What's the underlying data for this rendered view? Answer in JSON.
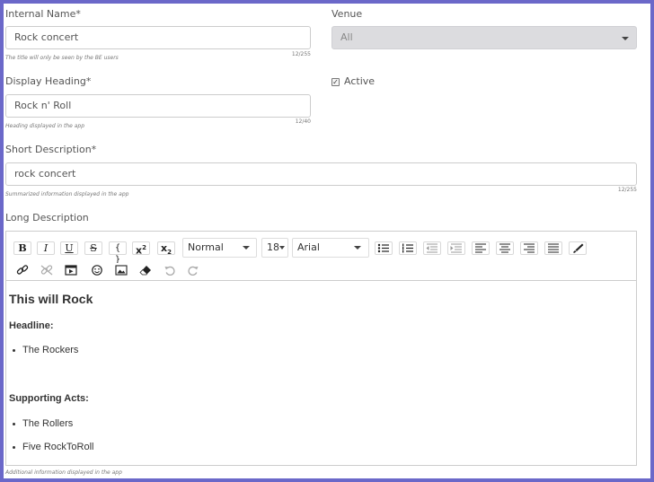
{
  "internal_name": {
    "label": "Internal Name*",
    "value": "Rock concert",
    "hint": "The title will only be seen by the BE users",
    "counter": "12/255"
  },
  "venue": {
    "label": "Venue",
    "selected": "All"
  },
  "display_heading": {
    "label": "Display Heading*",
    "value": "Rock n' Roll",
    "hint": "Heading displayed in the app",
    "counter": "12/40"
  },
  "active": {
    "label": "Active",
    "checked": true
  },
  "short_description": {
    "label": "Short Description*",
    "value": "rock concert",
    "hint": "Summarized information displayed in the app",
    "counter": "12/255"
  },
  "long_description": {
    "label": "Long Description",
    "hint": "Additional information displayed in the app",
    "toolbar": {
      "bold": "B",
      "italic": "I",
      "underline": "U",
      "strike": "S",
      "code": "{ }",
      "superscript_base": "x",
      "superscript_mark": "2",
      "subscript_base": "x",
      "subscript_mark": "2",
      "format": "Normal",
      "font_size": "18",
      "font_family": "Arial"
    },
    "content": {
      "title": "This will Rock",
      "headline_label": "Headline:",
      "headline_items": [
        "The Rockers"
      ],
      "support_label": "Supporting Acts:",
      "support_items": [
        "The Rollers",
        "Five RockToRoll"
      ]
    }
  },
  "colors": {
    "frame": "#6b68c9",
    "disabled_select": "#dcdcdf"
  }
}
